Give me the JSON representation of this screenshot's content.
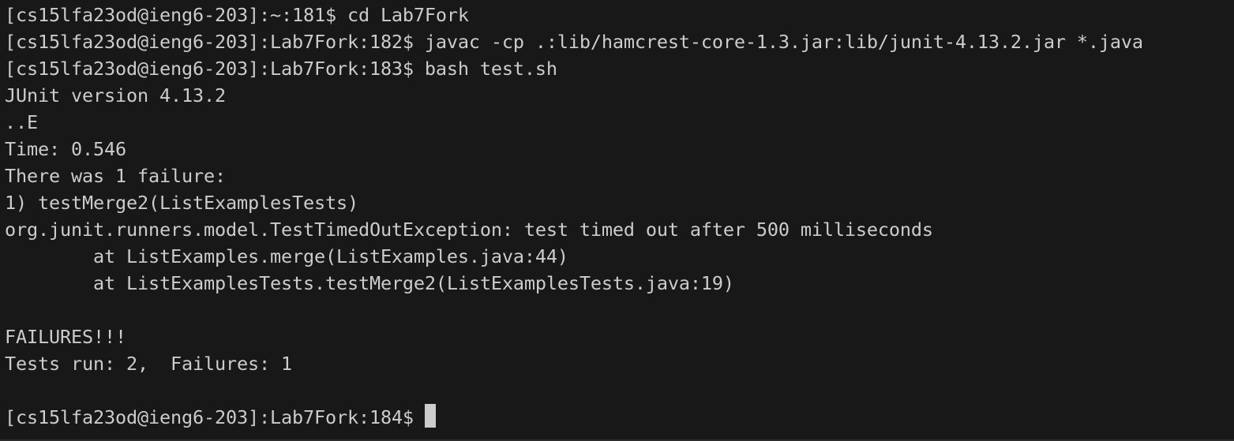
{
  "terminal": {
    "lines": [
      "[cs15lfa23od@ieng6-203]:~:181$ cd Lab7Fork",
      "[cs15lfa23od@ieng6-203]:Lab7Fork:182$ javac -cp .:lib/hamcrest-core-1.3.jar:lib/junit-4.13.2.jar *.java",
      "[cs15lfa23od@ieng6-203]:Lab7Fork:183$ bash test.sh",
      "JUnit version 4.13.2",
      "..E",
      "Time: 0.546",
      "There was 1 failure:",
      "1) testMerge2(ListExamplesTests)",
      "org.junit.runners.model.TestTimedOutException: test timed out after 500 milliseconds",
      "        at ListExamples.merge(ListExamples.java:44)",
      "        at ListExamplesTests.testMerge2(ListExamplesTests.java:19)",
      "",
      "FAILURES!!!",
      "Tests run: 2,  Failures: 1",
      "",
      "[cs15lfa23od@ieng6-203]:Lab7Fork:184$ "
    ]
  },
  "colors": {
    "background": "#181818",
    "foreground": "#cccccc"
  }
}
